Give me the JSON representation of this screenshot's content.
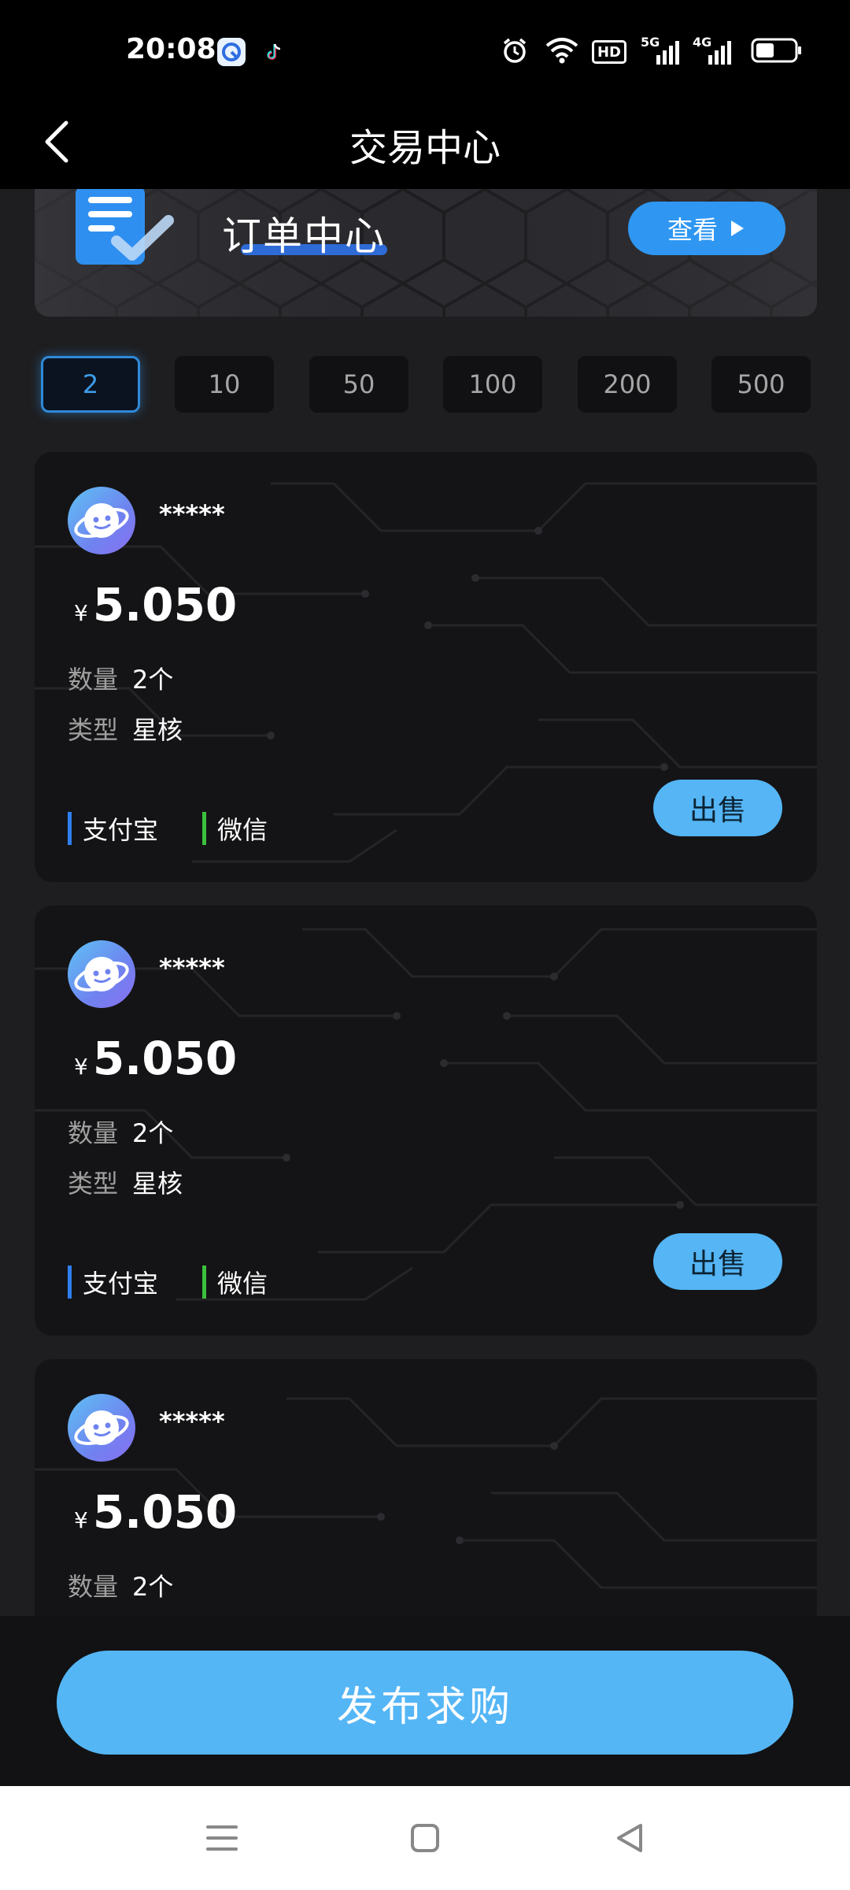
{
  "status_bar": {
    "time": "20:08",
    "icons": [
      "qq-browser-icon",
      "tiktok-icon",
      "alarm-icon",
      "wifi-icon",
      "hd-icon",
      "signal-5g-icon",
      "signal-4g-icon",
      "battery-icon"
    ],
    "hd_label": "HD",
    "sig1_label": "5G",
    "sig2_label": "4G"
  },
  "header": {
    "title": "交易中心",
    "back_icon": "chevron-left-icon"
  },
  "banner": {
    "title": "订单中心",
    "view_label": "查看",
    "icon": "document-check-icon"
  },
  "amounts": [
    {
      "label": "2",
      "active": true
    },
    {
      "label": "10",
      "active": false
    },
    {
      "label": "50",
      "active": false
    },
    {
      "label": "100",
      "active": false
    },
    {
      "label": "200",
      "active": false
    },
    {
      "label": "500",
      "active": false
    }
  ],
  "cards": [
    {
      "seller": "*****",
      "currency": "¥",
      "price": "5.050",
      "qty_label": "数量",
      "qty": "2个",
      "type_label": "类型",
      "type": "星核",
      "pay1": "支付宝",
      "pay2": "微信",
      "sell_label": "出售"
    },
    {
      "seller": "*****",
      "currency": "¥",
      "price": "5.050",
      "qty_label": "数量",
      "qty": "2个",
      "type_label": "类型",
      "type": "星核",
      "pay1": "支付宝",
      "pay2": "微信",
      "sell_label": "出售"
    },
    {
      "seller": "*****",
      "currency": "¥",
      "price": "5.050",
      "qty_label": "数量",
      "qty": "2个"
    }
  ],
  "publish_label": "发布求购",
  "colors": {
    "accent": "#55b6f6",
    "alipay": "#2f7ff0",
    "wechat": "#3bc13b",
    "active_chip": "#2f89d8"
  },
  "nav": {
    "icons": [
      "menu-icon",
      "home-square-icon",
      "back-triangle-icon"
    ]
  }
}
